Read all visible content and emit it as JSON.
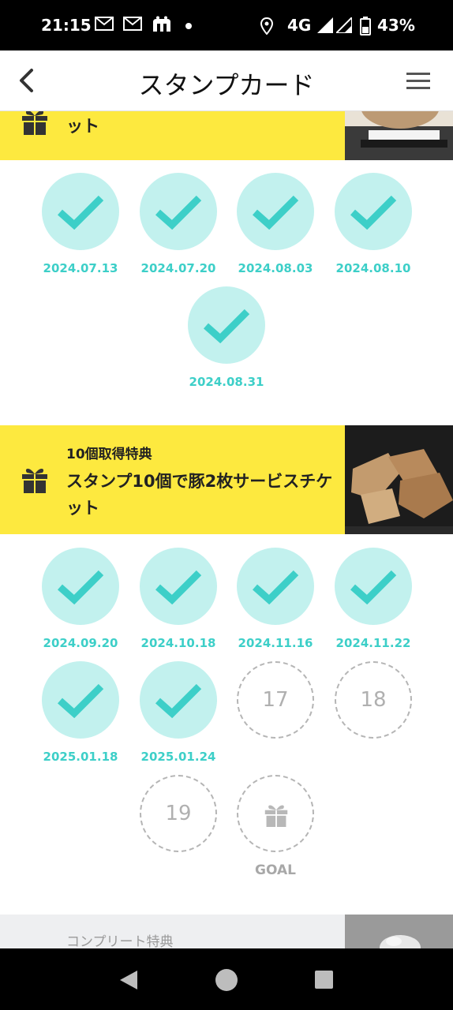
{
  "status_bar": {
    "time": "21:15",
    "network": "4G",
    "battery": "43%",
    "icons": [
      "mail-icon",
      "mail-icon",
      "app-notification-icon",
      "dot-icon",
      "location-icon",
      "signal-icon",
      "signal-icon",
      "battery-icon"
    ]
  },
  "app_bar": {
    "title": "スタンプカード",
    "back_icon": "chevron-left-icon",
    "menu_icon": "hamburger-menu-icon"
  },
  "reward_1": {
    "title_tail": "ット",
    "icon": "gift-icon",
    "stamps": [
      {
        "state": "done",
        "date": "2024.07.13"
      },
      {
        "state": "done",
        "date": "2024.07.20"
      },
      {
        "state": "done",
        "date": "2024.08.03"
      },
      {
        "state": "done",
        "date": "2024.08.10"
      },
      {
        "state": "done",
        "date": "2024.08.31"
      }
    ]
  },
  "reward_2": {
    "subtitle": "10個取得特典",
    "title": "スタンプ10個で豚2枚サービスチケット",
    "icon": "gift-icon",
    "stamps": [
      {
        "state": "done",
        "date": "2024.09.20"
      },
      {
        "state": "done",
        "date": "2024.10.18"
      },
      {
        "state": "done",
        "date": "2024.11.16"
      },
      {
        "state": "done",
        "date": "2024.11.22"
      },
      {
        "state": "done",
        "date": "2025.01.18"
      },
      {
        "state": "done",
        "date": "2025.01.24"
      },
      {
        "state": "empty",
        "number": "17"
      },
      {
        "state": "empty",
        "number": "18"
      },
      {
        "state": "empty",
        "number": "19"
      },
      {
        "state": "goal",
        "label": "GOAL",
        "icon": "gift-icon"
      }
    ]
  },
  "complete": {
    "subtitle": "コンプリート特典"
  },
  "colors": {
    "reward_banner": "#fde93f",
    "stamp_fill": "#c2f1ee",
    "check": "#3dcfc8",
    "date_text": "#3dcfc8",
    "empty_border": "#b5b5b5"
  },
  "nav_bar": {
    "icons": [
      "back-triangle-icon",
      "home-circle-icon",
      "recents-square-icon"
    ]
  }
}
